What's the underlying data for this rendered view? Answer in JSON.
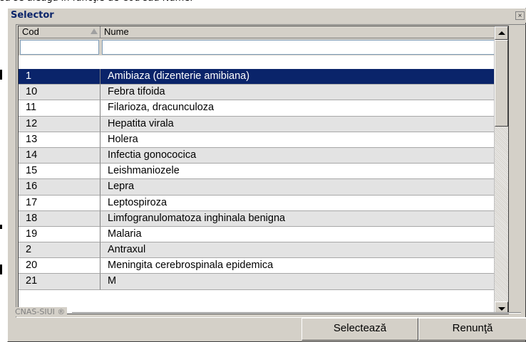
{
  "document": {
    "heading_text": "să se aleagă în funcţie de Cod sau Nume."
  },
  "window": {
    "title": "Selector",
    "close_symbol": "×"
  },
  "grid": {
    "columns": [
      {
        "label": "Cod"
      },
      {
        "label": "Nume"
      }
    ],
    "filters": {
      "cod_value": "",
      "nume_value": ""
    },
    "rows": [
      {
        "cod": "1",
        "nume": "Amibiaza (dizenterie amibiana)",
        "selected": true
      },
      {
        "cod": "10",
        "nume": "Febra tifoida"
      },
      {
        "cod": "11",
        "nume": "Filarioza, dracunculoza"
      },
      {
        "cod": "12",
        "nume": "Hepatita virala"
      },
      {
        "cod": "13",
        "nume": "Holera"
      },
      {
        "cod": "14",
        "nume": "Infectia gonococica"
      },
      {
        "cod": "15",
        "nume": "Leishmaniozele"
      },
      {
        "cod": "16",
        "nume": "Lepra"
      },
      {
        "cod": "17",
        "nume": "Leptospiroza"
      },
      {
        "cod": "18",
        "nume": "Limfogranulomatoza inghinala benigna"
      },
      {
        "cod": "19",
        "nume": "Malaria"
      },
      {
        "cod": "2",
        "nume": "Antraxul"
      },
      {
        "cod": "20",
        "nume": "Meningita cerebrospinala epidemica"
      },
      {
        "cod": "21",
        "nume": "M"
      }
    ]
  },
  "footer": {
    "brand_label": "CNAS-SIUI ®",
    "select_button": "Selectează",
    "cancel_button": "Renunţă"
  },
  "colors": {
    "selection": "#0a246a",
    "alt_row": "#e3e3e3",
    "window_bg": "#d4d0c8"
  },
  "icons": {
    "sort": "sort-ascending-icon",
    "scroll_up": "arrow-up-icon",
    "scroll_down": "arrow-down-icon",
    "close": "close-icon"
  }
}
